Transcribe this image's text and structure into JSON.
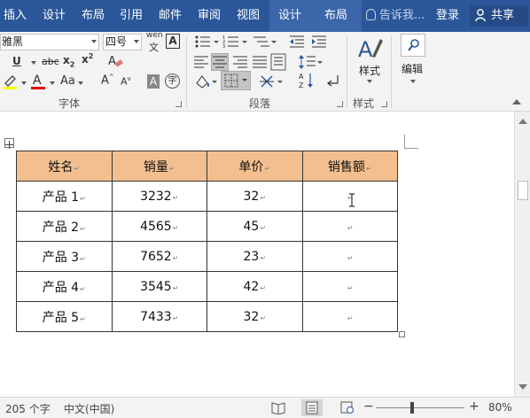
{
  "ribbon_tabs": [
    {
      "label": "插入"
    },
    {
      "label": "设计"
    },
    {
      "label": "布局"
    },
    {
      "label": "引用"
    },
    {
      "label": "邮件"
    },
    {
      "label": "审阅"
    },
    {
      "label": "视图"
    },
    {
      "label": "设计"
    },
    {
      "label": "布局"
    }
  ],
  "tell_me": {
    "placeholder": "告诉我..."
  },
  "login_label": "登录",
  "share_label": "共享",
  "font": {
    "name": "雅黑",
    "size": "四号",
    "pinyin_glyph": "wén",
    "border_glyph": "A",
    "group_label": "字体"
  },
  "paragraph": {
    "group_label": "段落"
  },
  "styles": {
    "button_label": "样式",
    "group_label": "样式"
  },
  "editing": {
    "button_label": "编辑"
  },
  "table": {
    "headers": [
      "姓名",
      "销量",
      "单价",
      "销售额"
    ],
    "rows": [
      [
        "产品 1",
        "3232",
        "32",
        ""
      ],
      [
        "产品 2",
        "4565",
        "45",
        ""
      ],
      [
        "产品 3",
        "7652",
        "23",
        ""
      ],
      [
        "产品 4",
        "3545",
        "42",
        ""
      ],
      [
        "产品 5",
        "7433",
        "32",
        ""
      ]
    ]
  },
  "status": {
    "word_count": "205 个字",
    "language": "中文(中国)",
    "zoom": "80%"
  },
  "colors": {
    "ribbon_blue": "#2b579a",
    "header_fill": "#f4bf8f",
    "highlight_yellow": "#ffff00",
    "font_red": "#e00000"
  }
}
